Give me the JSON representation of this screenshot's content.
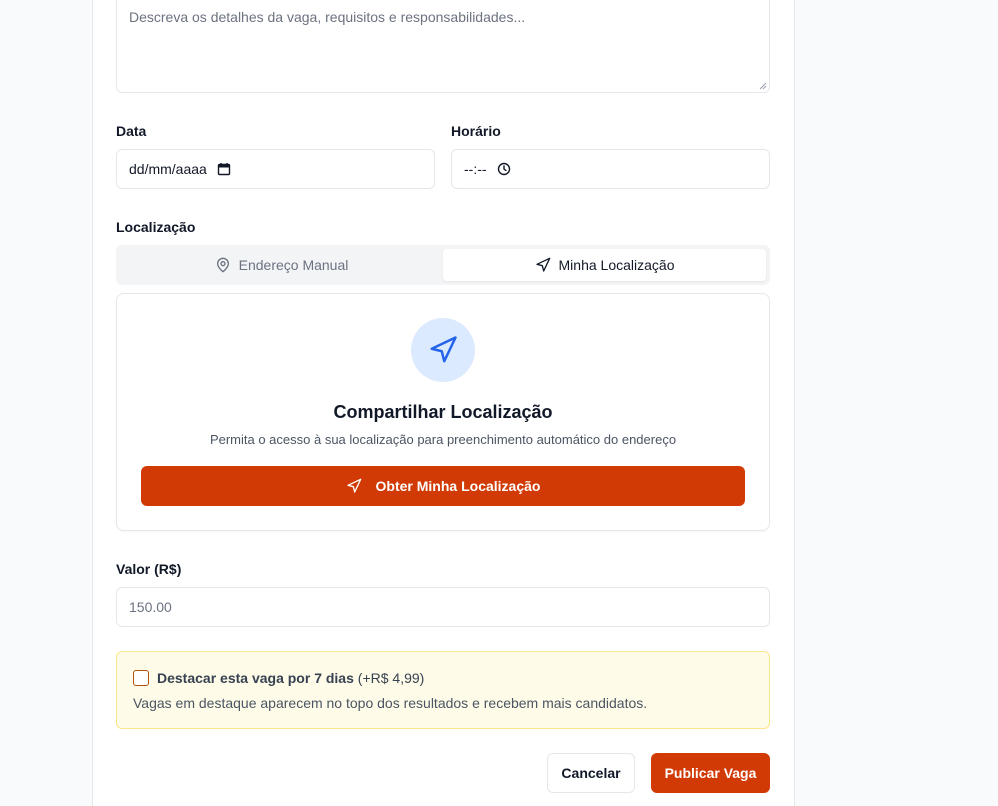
{
  "description": {
    "placeholder": "Descreva os detalhes da vaga, requisitos e responsabilidades..."
  },
  "date": {
    "label": "Data",
    "value": "dd/mm/aaaa",
    "icon": "calendar-icon"
  },
  "time": {
    "label": "Horário",
    "value": "--:--",
    "icon": "clock-icon"
  },
  "location": {
    "label": "Localização",
    "tabs": [
      {
        "label": "Endereço Manual",
        "icon": "map-pin-icon",
        "active": false
      },
      {
        "label": "Minha Localização",
        "icon": "navigation-icon",
        "active": true
      }
    ],
    "panel": {
      "icon": "navigation-icon",
      "title": "Compartilhar Localização",
      "description": "Permita o acesso à sua localização para preenchimento automático do endereço",
      "button_label": "Obter Minha Localização"
    }
  },
  "price": {
    "label": "Valor (R$)",
    "placeholder": "150.00"
  },
  "feature": {
    "label": "Destacar esta vaga por 7 dias",
    "price_text": "(+R$ 4,99)",
    "description": "Vagas em destaque aparecem no topo dos resultados e recebem mais candidatos.",
    "checked": false
  },
  "actions": {
    "cancel_label": "Cancelar",
    "publish_label": "Publicar Vaga"
  },
  "colors": {
    "primary": "#d13a05",
    "icon_circle_bg": "#dbeafe",
    "icon_blue": "#2563eb",
    "feature_bg": "#fefce8",
    "feature_border": "#fde68a"
  }
}
